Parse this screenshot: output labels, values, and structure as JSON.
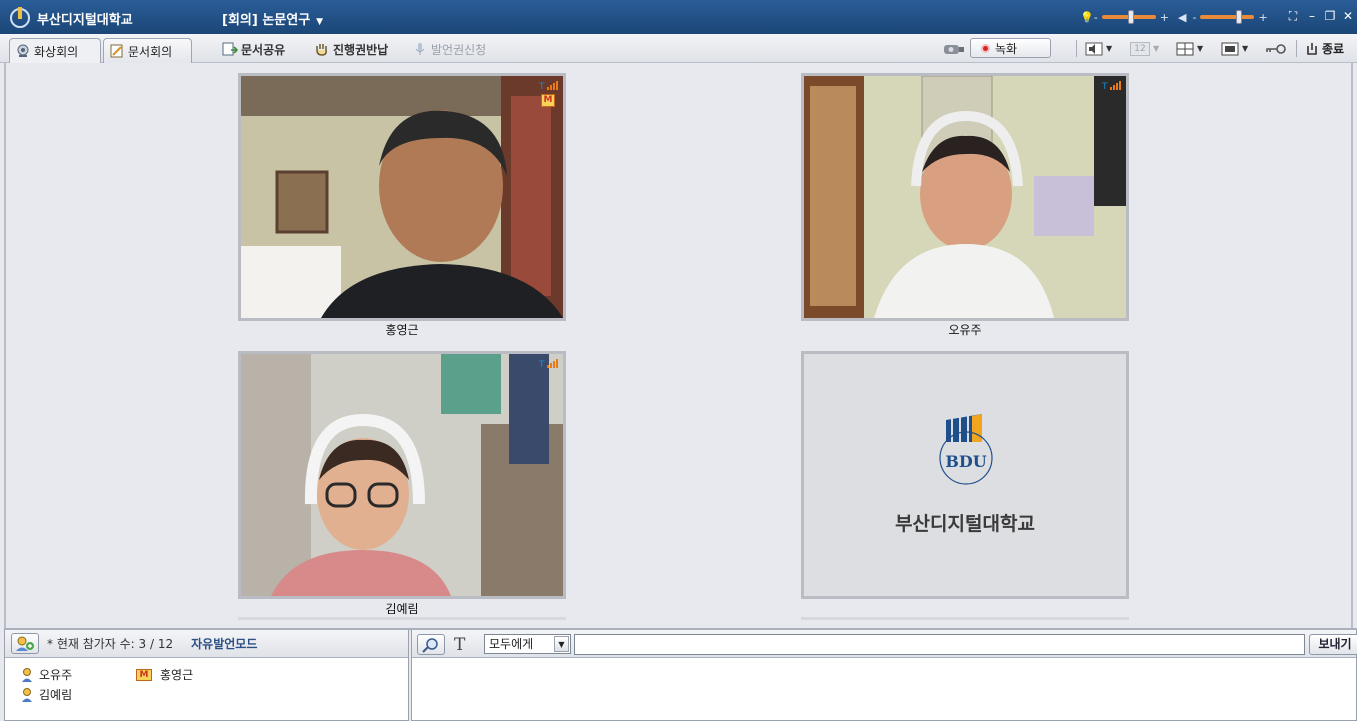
{
  "app": {
    "title": "부산디지털대학교",
    "meeting_title": "[회의] 논문연구"
  },
  "window_controls": {
    "volume_minus": "-",
    "volume_plus": "+",
    "mic_minus": "-",
    "mic_plus": "+"
  },
  "tabs": [
    {
      "label": "화상회의",
      "active": true
    },
    {
      "label": "문서회의",
      "active": false
    }
  ],
  "toolbar": {
    "doc_share": "문서공유",
    "return_control": "진행권반납",
    "request_speak": "발언권신청",
    "record": "녹화",
    "page_indicator": "12",
    "end": "종료"
  },
  "participants_video": [
    {
      "name": "홍영근",
      "is_moderator": true,
      "moderator_badge": "M"
    },
    {
      "name": "오유주",
      "is_moderator": false
    },
    {
      "name": "김예림",
      "is_moderator": false
    },
    {
      "name": "",
      "placeholder_logo_text": "부산디지털대학교",
      "logo_abbr": "BDU"
    }
  ],
  "participants_panel": {
    "count_label": "* 현재 참가자 수: 3 / 12",
    "mode": "자유발언모드",
    "list": [
      {
        "name": "오유주",
        "moderator": false
      },
      {
        "name": "홍영근",
        "moderator": true,
        "badge": "M"
      },
      {
        "name": "김예림",
        "moderator": false
      }
    ]
  },
  "chat": {
    "font_icon": "T",
    "recipient": "모두에게",
    "input_value": "",
    "send": "보내기"
  },
  "colors": {
    "titlebar": "#1b4677",
    "accent_orange": "#e88a3a",
    "record_red": "#dd2222",
    "mode_text": "#2c4f86"
  }
}
